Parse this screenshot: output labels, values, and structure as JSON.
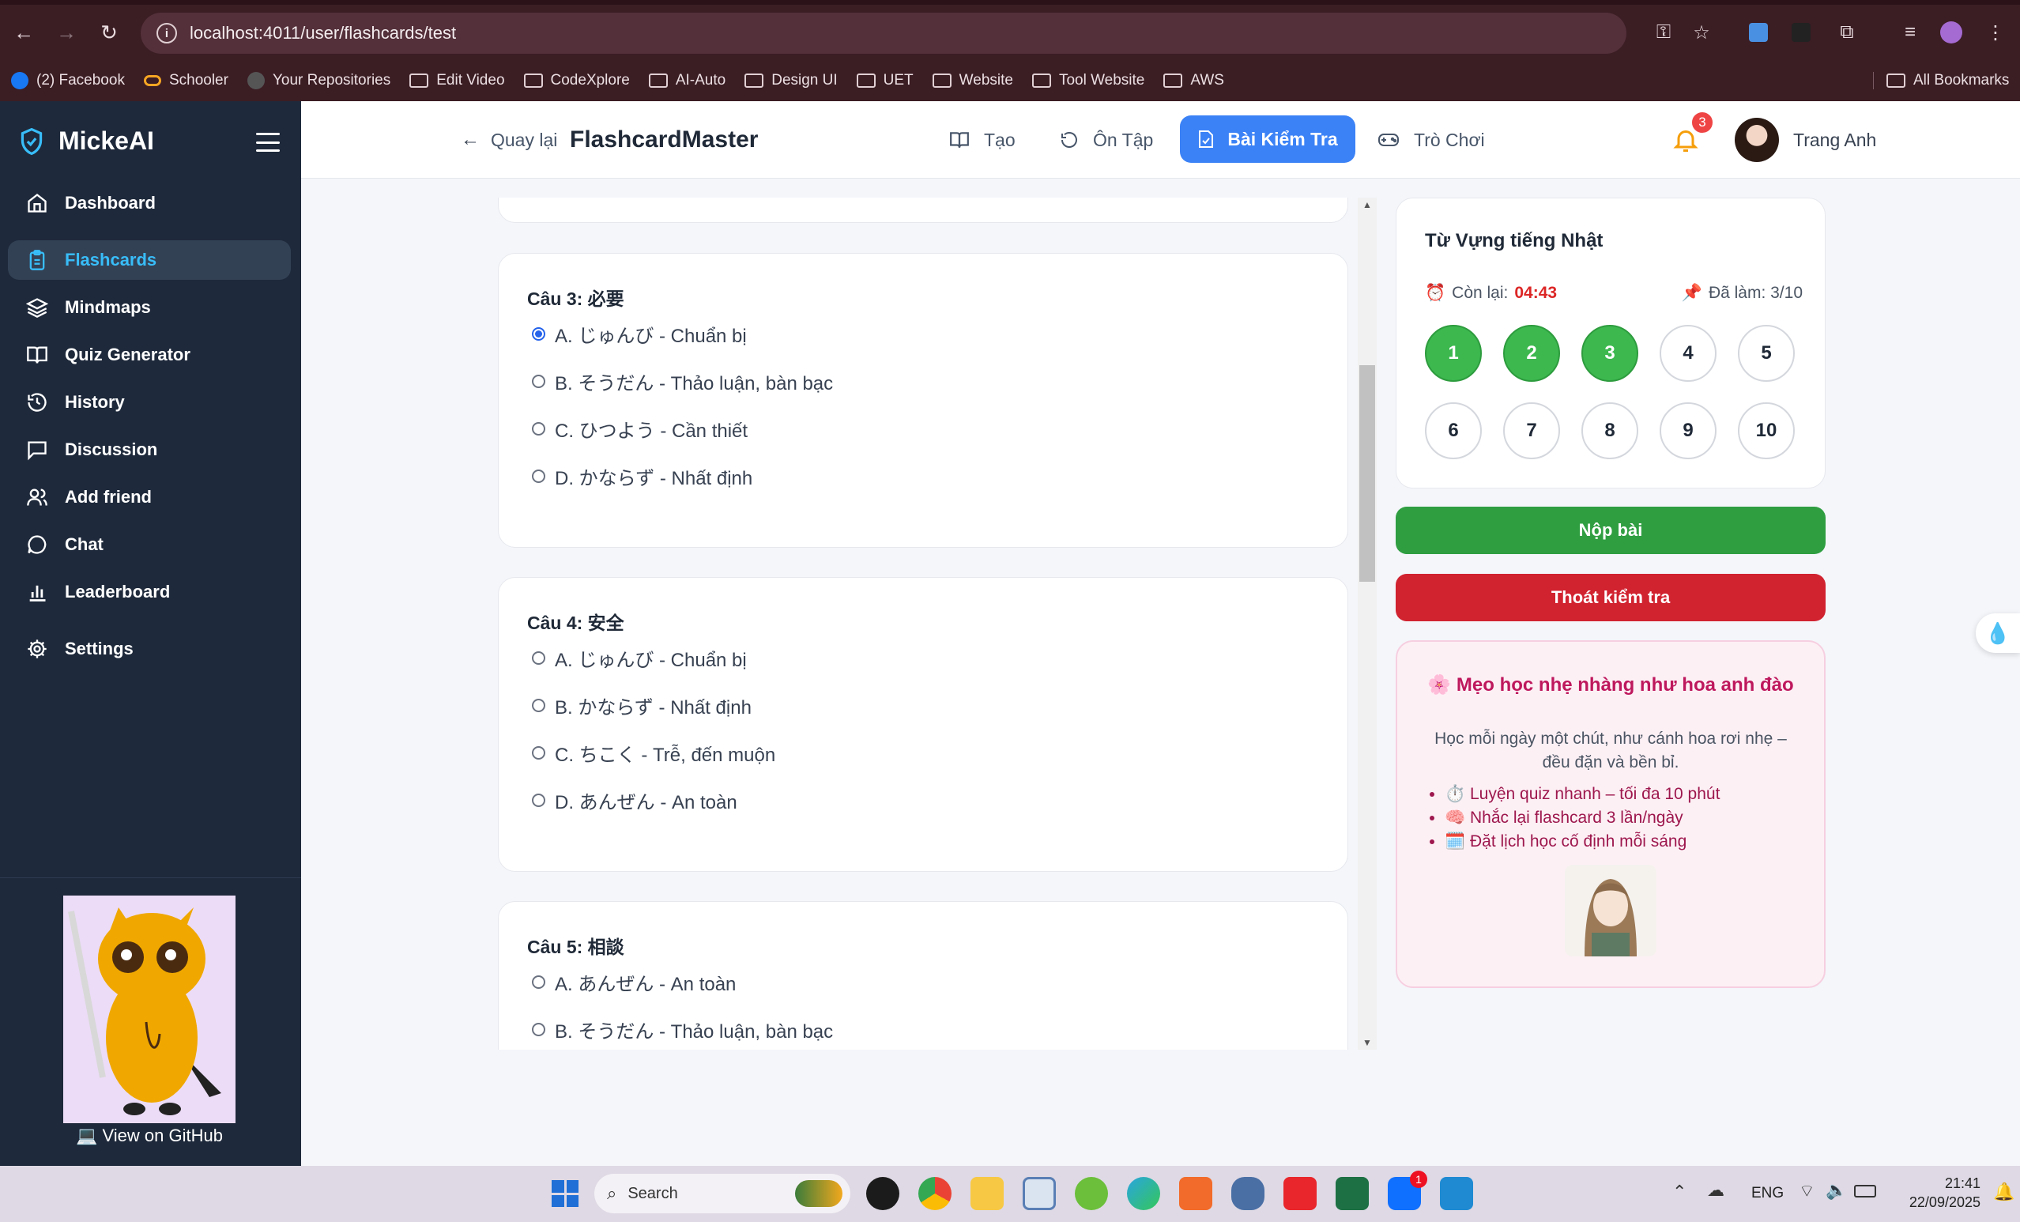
{
  "browser": {
    "url": "localhost:4011/user/flashcards/test",
    "bookmarks": [
      "(2) Facebook",
      "Schooler",
      "Your Repositories",
      "Edit Video",
      "CodeXplore",
      "AI-Auto",
      "Design UI",
      "UET",
      "Website",
      "Tool Website",
      "AWS"
    ],
    "all_bookmarks": "All Bookmarks"
  },
  "sidebar": {
    "brand": "MickeAI",
    "items": [
      {
        "label": "Dashboard",
        "icon": "home-icon"
      },
      {
        "label": "Flashcards",
        "icon": "clipboard-icon",
        "active": true
      },
      {
        "label": "Mindmaps",
        "icon": "layers-icon"
      },
      {
        "label": "Quiz Generator",
        "icon": "book-icon"
      },
      {
        "label": "History",
        "icon": "history-icon"
      },
      {
        "label": "Discussion",
        "icon": "message-square-icon"
      },
      {
        "label": "Add friend",
        "icon": "users-icon"
      },
      {
        "label": "Chat",
        "icon": "chat-bubble-icon"
      },
      {
        "label": "Leaderboard",
        "icon": "bar-chart-icon"
      },
      {
        "label": "Settings",
        "icon": "gear-icon"
      }
    ],
    "github": "💻 View on GitHub"
  },
  "header": {
    "back": "Quay lại",
    "title": "FlashcardMaster",
    "tabs": [
      "Tạo",
      "Ôn Tập",
      "Bài Kiểm Tra",
      "Trò Chơi"
    ],
    "notifications": "3",
    "user": "Trang Anh"
  },
  "questions": [
    {
      "title": "Câu 3: 必要",
      "options": [
        "A. じゅんび - Chuẩn bị",
        "B. そうだん - Thảo luận, bàn bạc",
        "C. ひつよう - Cần thiết",
        "D. かならず - Nhất định"
      ],
      "selected": 0
    },
    {
      "title": "Câu 4: 安全",
      "options": [
        "A. じゅんび - Chuẩn bị",
        "B. かならず - Nhất định",
        "C. ちこく - Trễ, đến muộn",
        "D. あんぜん - An toàn"
      ],
      "selected": -1
    },
    {
      "title": "Câu 5: 相談",
      "options": [
        "A. あんぜん - An toàn",
        "B. そうだん - Thảo luận, bàn bạc"
      ],
      "selected": -1
    }
  ],
  "panel": {
    "deck": "Từ Vựng tiếng Nhật",
    "remaining_label": "Còn lại:",
    "remaining": "04:43",
    "progress": "Đã làm: 3/10",
    "numbers": [
      "1",
      "2",
      "3",
      "4",
      "5",
      "6",
      "7",
      "8",
      "9",
      "10"
    ],
    "answered": 3,
    "submit": "Nộp bài",
    "exit": "Thoát kiểm tra"
  },
  "tips": {
    "title": "Mẹo học nhẹ nhàng như hoa anh đào",
    "desc1": "Học mỗi ngày một chút, như cánh hoa rơi nhẹ –",
    "desc2": "đều đặn và bền bỉ.",
    "items": [
      "⏱️ Luyện quiz nhanh – tối đa 10 phút",
      "🧠 Nhắc lại flashcard 3 lần/ngày",
      "🗓️ Đặt lịch học cố định mỗi sáng"
    ]
  },
  "taskbar": {
    "search": "Search",
    "lang": "ENG",
    "time": "21:41",
    "date": "22/09/2025",
    "badge": "1"
  },
  "colors": {
    "accent": "#3b82f6",
    "sidebar": "#1e293b",
    "done": "#3cb84f",
    "danger": "#d12230"
  }
}
